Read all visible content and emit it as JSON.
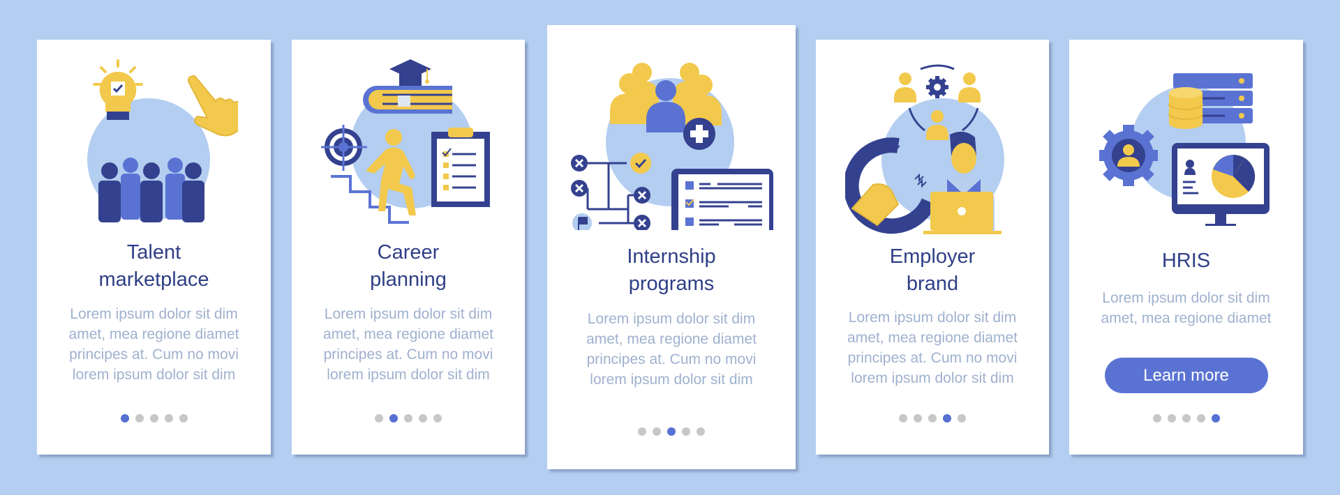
{
  "colors": {
    "background": "#b3cef0",
    "card": "#ffffff",
    "title": "#2f3f86",
    "body_text": "#9fb1cf",
    "dot_inactive": "#c7c7c9",
    "dot_active": "#5670d4",
    "button": "#5a73d3",
    "illustration_navy": "#34418f",
    "illustration_blue": "#5a73d3",
    "illustration_yellow": "#f2c94c",
    "illustration_circle": "#b3cef0"
  },
  "cards": [
    {
      "illustration": "talent-marketplace-illustration",
      "title_lines": [
        "Talent",
        "marketplace"
      ],
      "body_lines": [
        "Lorem ipsum dolor sit dim",
        "amet, mea regione diamet",
        "principes at. Cum no movi",
        "lorem ipsum dolor sit dim"
      ],
      "active_page": 1,
      "total_pages": 5
    },
    {
      "illustration": "career-planning-illustration",
      "title_lines": [
        "Career",
        "planning"
      ],
      "body_lines": [
        "Lorem ipsum dolor sit dim",
        "amet, mea regione diamet",
        "principes at. Cum no movi",
        "lorem ipsum dolor sit dim"
      ],
      "active_page": 2,
      "total_pages": 5
    },
    {
      "illustration": "internship-programs-illustration",
      "title_lines": [
        "Internship",
        "programs"
      ],
      "body_lines": [
        "Lorem ipsum dolor sit dim",
        "amet, mea regione diamet",
        "principes at. Cum no movi",
        "lorem ipsum dolor sit dim"
      ],
      "active_page": 3,
      "total_pages": 5
    },
    {
      "illustration": "employer-brand-illustration",
      "title_lines": [
        "Employer",
        "brand"
      ],
      "body_lines": [
        "Lorem ipsum dolor sit dim",
        "amet, mea regione diamet",
        "principes at. Cum no movi",
        "lorem ipsum dolor sit dim"
      ],
      "active_page": 4,
      "total_pages": 5
    },
    {
      "illustration": "hris-illustration",
      "title_lines": [
        "HRIS"
      ],
      "body_lines": [
        "Lorem ipsum dolor sit dim",
        "amet, mea regione diamet"
      ],
      "button_label": "Learn more",
      "active_page": 5,
      "total_pages": 5
    }
  ]
}
